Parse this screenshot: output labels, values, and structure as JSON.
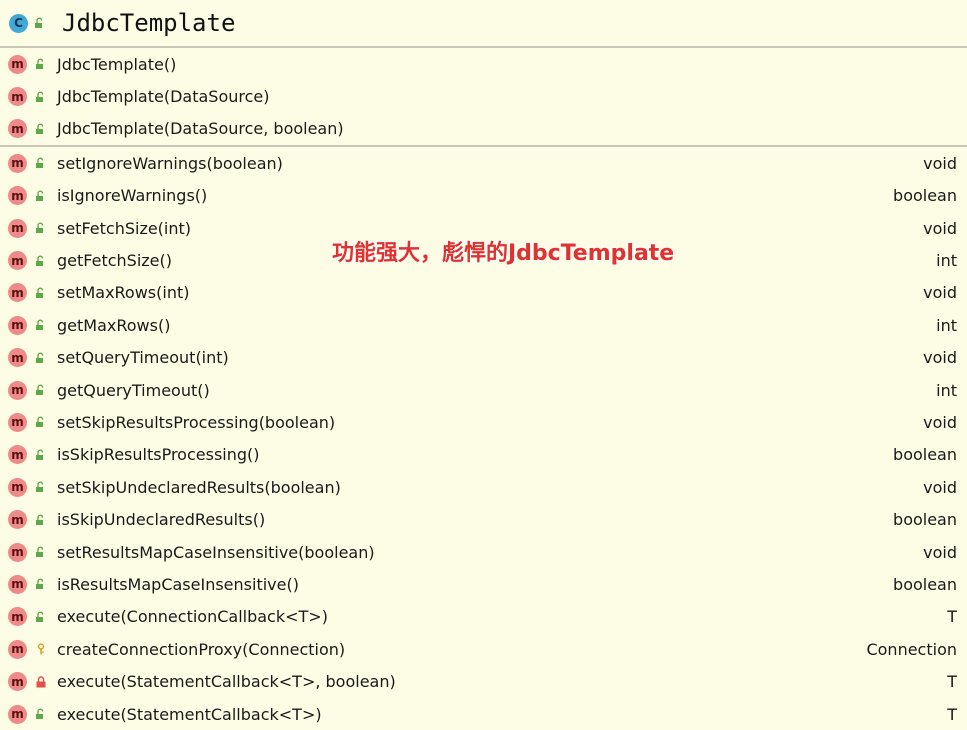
{
  "header": {
    "class_icon": "C",
    "title": "JdbcTemplate"
  },
  "constructors": [
    {
      "sig": "JdbcTemplate()",
      "vis": "public"
    },
    {
      "sig": "JdbcTemplate(DataSource)",
      "vis": "public"
    },
    {
      "sig": "JdbcTemplate(DataSource, boolean)",
      "vis": "public"
    }
  ],
  "methods": [
    {
      "sig": "setIgnoreWarnings(boolean)",
      "ret": "void",
      "vis": "public"
    },
    {
      "sig": "isIgnoreWarnings()",
      "ret": "boolean",
      "vis": "public"
    },
    {
      "sig": "setFetchSize(int)",
      "ret": "void",
      "vis": "public"
    },
    {
      "sig": "getFetchSize()",
      "ret": "int",
      "vis": "public"
    },
    {
      "sig": "setMaxRows(int)",
      "ret": "void",
      "vis": "public"
    },
    {
      "sig": "getMaxRows()",
      "ret": "int",
      "vis": "public"
    },
    {
      "sig": "setQueryTimeout(int)",
      "ret": "void",
      "vis": "public"
    },
    {
      "sig": "getQueryTimeout()",
      "ret": "int",
      "vis": "public"
    },
    {
      "sig": "setSkipResultsProcessing(boolean)",
      "ret": "void",
      "vis": "public"
    },
    {
      "sig": "isSkipResultsProcessing()",
      "ret": "boolean",
      "vis": "public"
    },
    {
      "sig": "setSkipUndeclaredResults(boolean)",
      "ret": "void",
      "vis": "public"
    },
    {
      "sig": "isSkipUndeclaredResults()",
      "ret": "boolean",
      "vis": "public"
    },
    {
      "sig": "setResultsMapCaseInsensitive(boolean)",
      "ret": "void",
      "vis": "public"
    },
    {
      "sig": "isResultsMapCaseInsensitive()",
      "ret": "boolean",
      "vis": "public"
    },
    {
      "sig": "execute(ConnectionCallback<T>)",
      "ret": "T",
      "vis": "public"
    },
    {
      "sig": "createConnectionProxy(Connection)",
      "ret": "Connection",
      "vis": "protected"
    },
    {
      "sig": "execute(StatementCallback<T>, boolean)",
      "ret": "T",
      "vis": "private"
    },
    {
      "sig": "execute(StatementCallback<T>)",
      "ret": "T",
      "vis": "public"
    }
  ],
  "method_icon": "m",
  "annotation": "功能强大，彪悍的JdbcTemplate",
  "colors": {
    "background": "#fdfde6",
    "class_icon": "#41a8d8",
    "method_icon": "#ee8a8a",
    "public_icon": "#5fa84a",
    "protected_icon": "#d9a21c",
    "private_icon": "#e0514a",
    "annotation": "#e0322e"
  }
}
